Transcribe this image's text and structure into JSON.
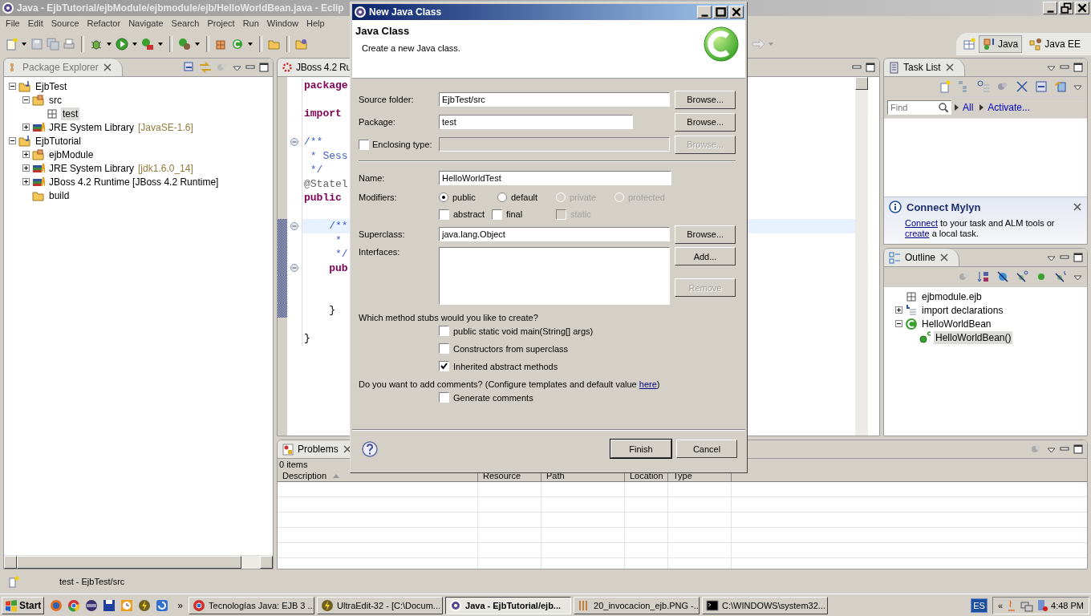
{
  "window": {
    "title": "Java - EjbTutorial/ejbModule/ejbmodule/ejb/HelloWorldBean.java - Eclip"
  },
  "menu": [
    "File",
    "Edit",
    "Source",
    "Refactor",
    "Navigate",
    "Search",
    "Project",
    "Run",
    "Window",
    "Help"
  ],
  "perspectives": [
    {
      "label": "Java",
      "selected": true
    },
    {
      "label": "Java EE",
      "selected": false
    }
  ],
  "package_explorer": {
    "title": "Package Explorer",
    "tree": [
      {
        "label": "EjbTest",
        "kind": "project",
        "expanded": true,
        "selected": false,
        "children": [
          {
            "label": "src",
            "kind": "source",
            "expanded": true,
            "selected": false,
            "children": [
              {
                "label": "test",
                "kind": "package",
                "selected": true
              }
            ]
          },
          {
            "label": "JRE System Library",
            "decoration": "[JavaSE-1.6]",
            "kind": "library",
            "expanded": false,
            "selected": false
          }
        ]
      },
      {
        "label": "EjbTutorial",
        "kind": "project",
        "expanded": true,
        "selected": false,
        "children": [
          {
            "label": "ejbModule",
            "kind": "source",
            "expanded": false,
            "selected": false
          },
          {
            "label": "JRE System Library",
            "decoration": "[jdk1.6.0_14]",
            "kind": "library",
            "expanded": false,
            "selected": false
          },
          {
            "label": "JBoss 4.2 Runtime [JBoss 4.2 Runtime]",
            "kind": "library",
            "expanded": false,
            "selected": false
          },
          {
            "label": "build",
            "kind": "folder",
            "selected": false
          }
        ]
      }
    ]
  },
  "editor": {
    "tab": "JBoss 4.2 Ru",
    "lines": [
      {
        "kind": "keyword",
        "text": "package"
      },
      {
        "kind": "blank"
      },
      {
        "kind": "keyword",
        "text": "import"
      },
      {
        "kind": "blank"
      },
      {
        "kind": "comment",
        "text": "/**",
        "fold": true
      },
      {
        "kind": "comment",
        "text": " * Sess"
      },
      {
        "kind": "comment",
        "text": " */"
      },
      {
        "kind": "annotation",
        "text": "@Statel"
      },
      {
        "kind": "keyword",
        "text": "public"
      },
      {
        "kind": "blank"
      },
      {
        "kind": "comment",
        "text": "    /**",
        "fold": true,
        "highlighted": true,
        "range": true
      },
      {
        "kind": "comment",
        "text": "     *",
        "range": true
      },
      {
        "kind": "comment",
        "text": "     */",
        "range": true
      },
      {
        "kind": "keyword",
        "text": "    pub",
        "fold": true,
        "range": true
      },
      {
        "kind": "blank",
        "range": true
      },
      {
        "kind": "blank",
        "range": true
      },
      {
        "kind": "plain",
        "text": "    }",
        "range": true
      },
      {
        "kind": "blank"
      },
      {
        "kind": "plain",
        "text": "}"
      }
    ]
  },
  "task_list": {
    "title": "Task List",
    "find_placeholder": "Find",
    "links": [
      "All",
      "Activate..."
    ],
    "mylyn": {
      "heading": "Connect Mylyn",
      "message": [
        {
          "kind": "link",
          "text": "Connect"
        },
        {
          "kind": "text",
          "text": " to your task and ALM tools or "
        },
        {
          "kind": "link",
          "text": "create"
        },
        {
          "kind": "text",
          "text": " a local task."
        }
      ]
    }
  },
  "outline": {
    "title": "Outline",
    "tree": [
      {
        "label": "ejbmodule.ejb",
        "kind": "package",
        "selected": false
      },
      {
        "label": "import declarations",
        "kind": "imports",
        "expanded": false,
        "selected": false
      },
      {
        "label": "HelloWorldBean",
        "kind": "class",
        "expanded": true,
        "selected": false,
        "children": [
          {
            "label": "HelloWorldBean()",
            "kind": "constructor",
            "selected": true
          }
        ]
      }
    ]
  },
  "problems": {
    "title": "Problems",
    "count": "0 items",
    "columns": [
      {
        "label": "Description",
        "sorted": true
      },
      {
        "label": "Resource",
        "sorted": false
      },
      {
        "label": "Path",
        "sorted": false
      },
      {
        "label": "Location",
        "sorted": false
      },
      {
        "label": "Type",
        "sorted": false
      }
    ]
  },
  "status_bar": {
    "text": "test - EjbTest/src"
  },
  "dialog": {
    "title": "New Java Class",
    "heading": "Java Class",
    "description": "Create a new Java class.",
    "source_folder": {
      "label": "Source folder:",
      "value": "EjbTest/src",
      "button": {
        "label": "Browse...",
        "disabled": false
      }
    },
    "package": {
      "label": "Package:",
      "value": "test",
      "button": {
        "label": "Browse...",
        "disabled": false
      }
    },
    "enclosing_type": {
      "label": "Enclosing type:",
      "checked": false,
      "button": {
        "label": "Browse...",
        "disabled": true
      }
    },
    "name": {
      "label": "Name:",
      "value": "HelloWorldTest"
    },
    "modifiers": {
      "label": "Modifiers:",
      "access": [
        {
          "label": "public",
          "selected": true,
          "disabled": false
        },
        {
          "label": "default",
          "selected": false,
          "disabled": false
        },
        {
          "label": "private",
          "selected": false,
          "disabled": true
        },
        {
          "label": "protected",
          "selected": false,
          "disabled": true
        }
      ],
      "flags": [
        {
          "label": "abstract",
          "checked": false,
          "disabled": false
        },
        {
          "label": "final",
          "checked": false,
          "disabled": false
        },
        {
          "label": "static",
          "checked": false,
          "disabled": true
        }
      ]
    },
    "superclass": {
      "label": "Superclass:",
      "value": "java.lang.Object",
      "button": {
        "label": "Browse...",
        "disabled": false
      }
    },
    "interfaces": {
      "label": "Interfaces:",
      "buttons": [
        {
          "label": "Add...",
          "disabled": false
        },
        {
          "label": "Remove",
          "disabled": true
        }
      ]
    },
    "stubs": {
      "question": "Which method stubs would you like to create?",
      "options": [
        {
          "label": "public static void main(String[] args)",
          "checked": false
        },
        {
          "label": "Constructors from superclass",
          "checked": false
        },
        {
          "label": "Inherited abstract methods",
          "checked": true
        }
      ]
    },
    "comments": {
      "question": [
        {
          "kind": "text",
          "text": "Do you want to add comments? (Configure templates and default value "
        },
        {
          "kind": "link",
          "text": "here"
        },
        {
          "kind": "text",
          "text": ")"
        }
      ],
      "options": [
        {
          "label": "Generate comments",
          "checked": false
        }
      ]
    },
    "buttons": [
      {
        "label": "Finish",
        "default": true
      },
      {
        "label": "Cancel",
        "default": false
      }
    ]
  },
  "taskbar": {
    "start": "Start",
    "more": "»",
    "tasks": [
      {
        "label": "Tecnologías Java: EJB 3 ...",
        "kind": "browser",
        "selected": false
      },
      {
        "label": "UltraEdit-32 - [C:\\Docum...",
        "kind": "editor",
        "selected": false
      },
      {
        "label": "Java - EjbTutorial/ejb...",
        "kind": "eclipse",
        "selected": true
      },
      {
        "label": "20_invocacion_ejb.PNG -...",
        "kind": "paint",
        "selected": false
      },
      {
        "label": "C:\\WINDOWS\\system32...",
        "kind": "console",
        "selected": false
      }
    ],
    "language": "ES",
    "tray_more": "«",
    "clock": "4:48 PM"
  }
}
